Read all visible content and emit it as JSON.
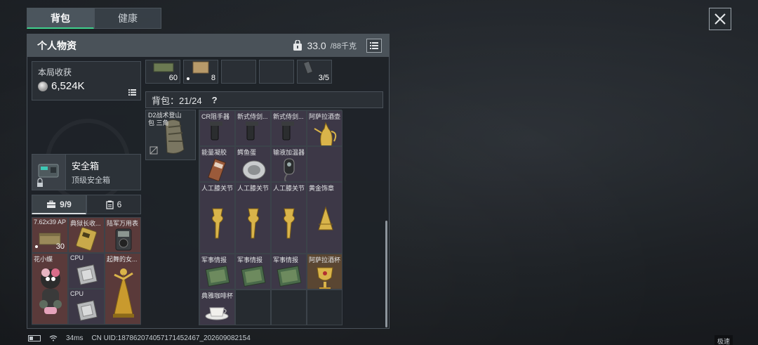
{
  "tabs": [
    {
      "label": "背包",
      "active": true
    },
    {
      "label": "健康",
      "active": false
    }
  ],
  "panel": {
    "title": "个人物资",
    "weight_value": "33.0",
    "weight_capacity": "/88千克"
  },
  "harvest": {
    "label": "本局收获",
    "value": "6,524K"
  },
  "safebox": {
    "title": "安全箱",
    "subtitle": "顶级安全箱"
  },
  "sub_tabs": [
    {
      "label": "9/9",
      "icon": "toolbox-icon",
      "active": true
    },
    {
      "label": "6",
      "icon": "clipboard-icon",
      "active": false
    }
  ],
  "pouch_items": [
    {
      "name": "7.62x39 AP",
      "qty": "30",
      "dot": true,
      "color": "red",
      "icon": "ammo-box"
    },
    {
      "name": "典狱长收...",
      "qty": "",
      "color": "red",
      "icon": "card"
    },
    {
      "name": "陆军万用表",
      "qty": "",
      "color": "red",
      "icon": "meter"
    },
    {
      "name": "花小蝶",
      "qty": "",
      "color": "red",
      "icon": "doll"
    },
    {
      "name": "CPU",
      "qty": "",
      "color": "purple",
      "icon": "cpu"
    },
    {
      "name": "起舞的女...",
      "qty": "",
      "color": "red",
      "icon": "statue"
    },
    {
      "name": "",
      "qty": "",
      "color": "red",
      "icon": ""
    },
    {
      "name": "CPU",
      "qty": "",
      "color": "purple",
      "icon": "cpu"
    },
    {
      "name": "",
      "qty": "",
      "color": "red",
      "icon": ""
    }
  ],
  "top_slots": [
    {
      "qty": "60",
      "dot": false,
      "icon": "ammo-crate"
    },
    {
      "qty": "8",
      "dot": true,
      "icon": "box"
    },
    {
      "qty": "",
      "dot": false,
      "icon": ""
    },
    {
      "qty": "",
      "dot": false,
      "icon": ""
    },
    {
      "qty": "3/5",
      "dot": false,
      "icon": "magazine"
    }
  ],
  "bag": {
    "label": "背包：",
    "count": "21/24",
    "help": "?"
  },
  "backpack": {
    "name": "D2战术登山包 三角"
  },
  "bag_items": [
    {
      "name": "CR阻手器",
      "color": "purple",
      "icon": "grip"
    },
    {
      "name": "新式侍剑...",
      "color": "purple",
      "icon": "grip"
    },
    {
      "name": "新式侍剑...",
      "color": "purple",
      "icon": "grip"
    },
    {
      "name": "阿萨拉酒壶",
      "color": "purple",
      "icon": "ewer"
    },
    {
      "name": "能量凝胶",
      "color": "purple",
      "icon": "gel"
    },
    {
      "name": "鳄鱼蛋",
      "color": "purple",
      "icon": "egg"
    },
    {
      "name": "输液加温器",
      "color": "purple",
      "icon": "warmer"
    },
    {
      "name": "",
      "color": "purple",
      "icon": ""
    },
    {
      "name": "人工膝关节",
      "color": "purple",
      "icon": "knee"
    },
    {
      "name": "人工膝关节",
      "color": "purple",
      "icon": "knee"
    },
    {
      "name": "人工膝关节",
      "color": "purple",
      "icon": "knee"
    },
    {
      "name": "黄金饰章",
      "color": "purple",
      "icon": "gold-badge"
    },
    {
      "name": "",
      "color": "purple",
      "icon": ""
    },
    {
      "name": "",
      "color": "purple",
      "icon": ""
    },
    {
      "name": "",
      "color": "purple",
      "icon": ""
    },
    {
      "name": "",
      "color": "purple",
      "icon": ""
    },
    {
      "name": "军事情报",
      "color": "purple",
      "icon": "intel"
    },
    {
      "name": "军事情报",
      "color": "purple",
      "icon": "intel"
    },
    {
      "name": "军事情报",
      "color": "purple",
      "icon": "intel"
    },
    {
      "name": "阿萨拉酒杯",
      "color": "orange",
      "icon": "goblet"
    },
    {
      "name": "典雅咖啡杯",
      "color": "purple",
      "icon": "cup"
    },
    {
      "name": "",
      "color": "empty",
      "icon": ""
    },
    {
      "name": "",
      "color": "empty",
      "icon": ""
    },
    {
      "name": "",
      "color": "empty",
      "icon": ""
    }
  ],
  "status": {
    "ping": "34ms",
    "uid": "CN UID:1878620740571714524​67_202609082154"
  },
  "speed_tag": "极速",
  "colors": {
    "accent": "#3fd08c",
    "red_slot": "#5a3a3a",
    "purple_slot": "#3d3847",
    "gold": "#d9b44a"
  }
}
